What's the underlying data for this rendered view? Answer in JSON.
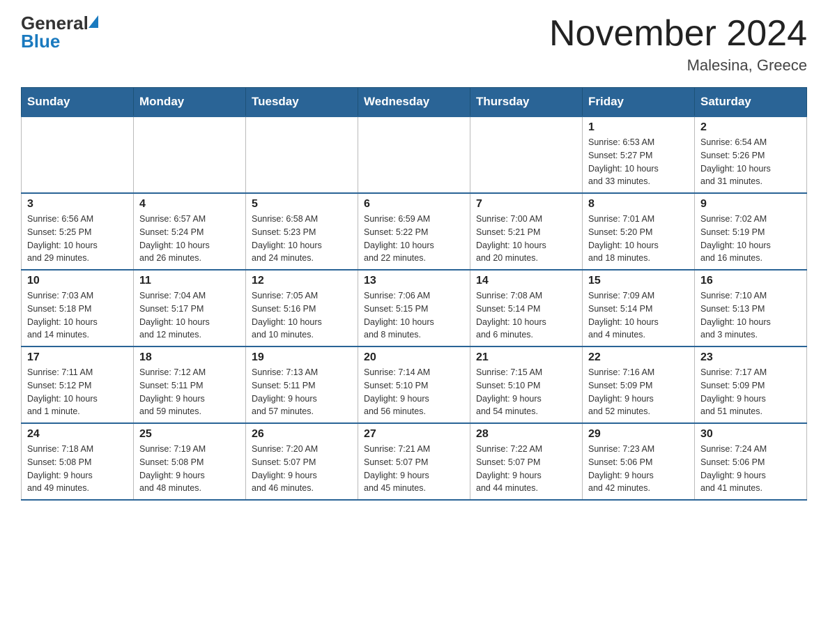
{
  "header": {
    "logo_general": "General",
    "logo_blue": "Blue",
    "month_title": "November 2024",
    "location": "Malesina, Greece"
  },
  "weekdays": [
    "Sunday",
    "Monday",
    "Tuesday",
    "Wednesday",
    "Thursday",
    "Friday",
    "Saturday"
  ],
  "weeks": [
    [
      {
        "day": "",
        "info": ""
      },
      {
        "day": "",
        "info": ""
      },
      {
        "day": "",
        "info": ""
      },
      {
        "day": "",
        "info": ""
      },
      {
        "day": "",
        "info": ""
      },
      {
        "day": "1",
        "info": "Sunrise: 6:53 AM\nSunset: 5:27 PM\nDaylight: 10 hours\nand 33 minutes."
      },
      {
        "day": "2",
        "info": "Sunrise: 6:54 AM\nSunset: 5:26 PM\nDaylight: 10 hours\nand 31 minutes."
      }
    ],
    [
      {
        "day": "3",
        "info": "Sunrise: 6:56 AM\nSunset: 5:25 PM\nDaylight: 10 hours\nand 29 minutes."
      },
      {
        "day": "4",
        "info": "Sunrise: 6:57 AM\nSunset: 5:24 PM\nDaylight: 10 hours\nand 26 minutes."
      },
      {
        "day": "5",
        "info": "Sunrise: 6:58 AM\nSunset: 5:23 PM\nDaylight: 10 hours\nand 24 minutes."
      },
      {
        "day": "6",
        "info": "Sunrise: 6:59 AM\nSunset: 5:22 PM\nDaylight: 10 hours\nand 22 minutes."
      },
      {
        "day": "7",
        "info": "Sunrise: 7:00 AM\nSunset: 5:21 PM\nDaylight: 10 hours\nand 20 minutes."
      },
      {
        "day": "8",
        "info": "Sunrise: 7:01 AM\nSunset: 5:20 PM\nDaylight: 10 hours\nand 18 minutes."
      },
      {
        "day": "9",
        "info": "Sunrise: 7:02 AM\nSunset: 5:19 PM\nDaylight: 10 hours\nand 16 minutes."
      }
    ],
    [
      {
        "day": "10",
        "info": "Sunrise: 7:03 AM\nSunset: 5:18 PM\nDaylight: 10 hours\nand 14 minutes."
      },
      {
        "day": "11",
        "info": "Sunrise: 7:04 AM\nSunset: 5:17 PM\nDaylight: 10 hours\nand 12 minutes."
      },
      {
        "day": "12",
        "info": "Sunrise: 7:05 AM\nSunset: 5:16 PM\nDaylight: 10 hours\nand 10 minutes."
      },
      {
        "day": "13",
        "info": "Sunrise: 7:06 AM\nSunset: 5:15 PM\nDaylight: 10 hours\nand 8 minutes."
      },
      {
        "day": "14",
        "info": "Sunrise: 7:08 AM\nSunset: 5:14 PM\nDaylight: 10 hours\nand 6 minutes."
      },
      {
        "day": "15",
        "info": "Sunrise: 7:09 AM\nSunset: 5:14 PM\nDaylight: 10 hours\nand 4 minutes."
      },
      {
        "day": "16",
        "info": "Sunrise: 7:10 AM\nSunset: 5:13 PM\nDaylight: 10 hours\nand 3 minutes."
      }
    ],
    [
      {
        "day": "17",
        "info": "Sunrise: 7:11 AM\nSunset: 5:12 PM\nDaylight: 10 hours\nand 1 minute."
      },
      {
        "day": "18",
        "info": "Sunrise: 7:12 AM\nSunset: 5:11 PM\nDaylight: 9 hours\nand 59 minutes."
      },
      {
        "day": "19",
        "info": "Sunrise: 7:13 AM\nSunset: 5:11 PM\nDaylight: 9 hours\nand 57 minutes."
      },
      {
        "day": "20",
        "info": "Sunrise: 7:14 AM\nSunset: 5:10 PM\nDaylight: 9 hours\nand 56 minutes."
      },
      {
        "day": "21",
        "info": "Sunrise: 7:15 AM\nSunset: 5:10 PM\nDaylight: 9 hours\nand 54 minutes."
      },
      {
        "day": "22",
        "info": "Sunrise: 7:16 AM\nSunset: 5:09 PM\nDaylight: 9 hours\nand 52 minutes."
      },
      {
        "day": "23",
        "info": "Sunrise: 7:17 AM\nSunset: 5:09 PM\nDaylight: 9 hours\nand 51 minutes."
      }
    ],
    [
      {
        "day": "24",
        "info": "Sunrise: 7:18 AM\nSunset: 5:08 PM\nDaylight: 9 hours\nand 49 minutes."
      },
      {
        "day": "25",
        "info": "Sunrise: 7:19 AM\nSunset: 5:08 PM\nDaylight: 9 hours\nand 48 minutes."
      },
      {
        "day": "26",
        "info": "Sunrise: 7:20 AM\nSunset: 5:07 PM\nDaylight: 9 hours\nand 46 minutes."
      },
      {
        "day": "27",
        "info": "Sunrise: 7:21 AM\nSunset: 5:07 PM\nDaylight: 9 hours\nand 45 minutes."
      },
      {
        "day": "28",
        "info": "Sunrise: 7:22 AM\nSunset: 5:07 PM\nDaylight: 9 hours\nand 44 minutes."
      },
      {
        "day": "29",
        "info": "Sunrise: 7:23 AM\nSunset: 5:06 PM\nDaylight: 9 hours\nand 42 minutes."
      },
      {
        "day": "30",
        "info": "Sunrise: 7:24 AM\nSunset: 5:06 PM\nDaylight: 9 hours\nand 41 minutes."
      }
    ]
  ]
}
